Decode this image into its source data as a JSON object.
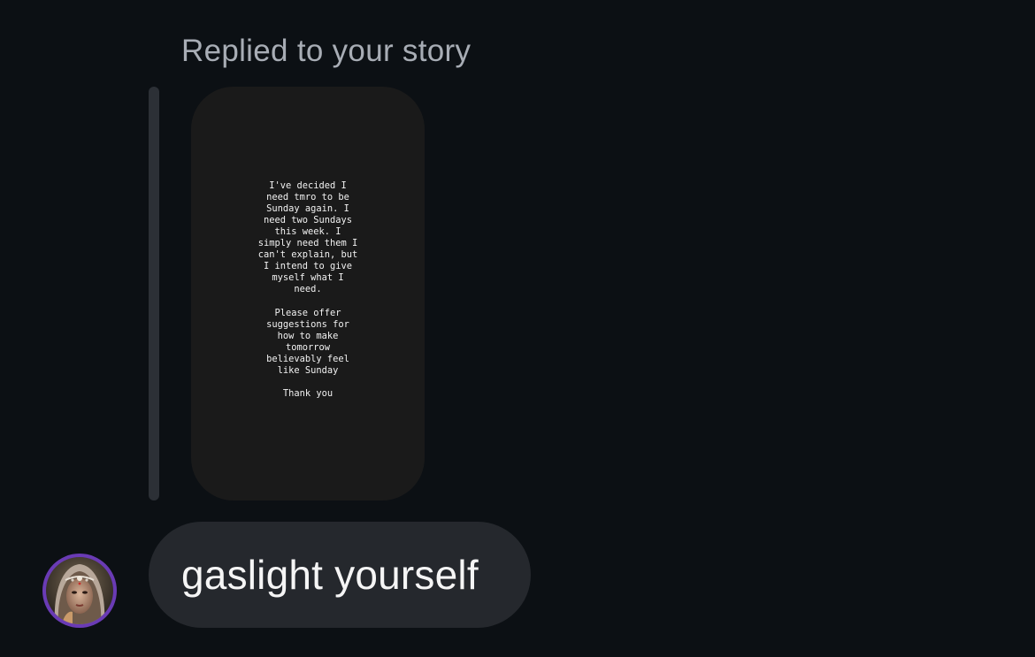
{
  "reply": {
    "label": "Replied to your story"
  },
  "story": {
    "text": "I've decided I\nneed tmro to be\nSunday again. I\nneed two Sundays\nthis week. I\nsimply need them I\ncan't explain, but\nI intend to give\nmyself what I\nneed.\n\nPlease offer\nsuggestions for\nhow to make\ntomorrow\nbelievably feel\nlike Sunday\n\nThank you",
    "background_color": "#1a1a1a"
  },
  "message": {
    "text": "gaslight yourself",
    "bubble_color": "#25282d"
  },
  "avatar": {
    "ring_color": "#6a3bb5"
  },
  "theme": {
    "background": "#0c1014"
  }
}
